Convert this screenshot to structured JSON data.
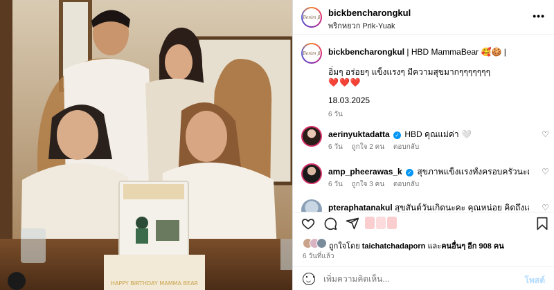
{
  "post": {
    "username": "bickbencharongkul",
    "location": "พริกหยวก Prik-Yuak",
    "avatar_text": "Benim ß"
  },
  "caption": {
    "username": "bickbencharongkul",
    "line1": "| HBD MammaBear 🥰🍪 |",
    "line2": "อิ่มๆ อร่อยๆ แข็งแรงๆ มีความสุขมากๆๆๆๆๆๆๆ",
    "hearts": "❤️❤️❤️",
    "date": "18.03.2025",
    "time": "6 วัน"
  },
  "comments": [
    {
      "username": "aerinyuktadatta",
      "text": "HBD คุณแม่ค่า 🤍",
      "time": "6 วัน",
      "likes": "ถูกใจ 2 คน",
      "reply": "ตอบกลับ"
    },
    {
      "username": "amp_pheerawas_k",
      "text": "สุขภาพแข็งแรงทั้งครอบครัวนะครับ",
      "time": "6 วัน",
      "likes": "ถูกใจ 3 คน",
      "reply": "ตอบกลับ"
    },
    {
      "username": "pteraphatanakul",
      "text": "สุขสันต์วันเกิดนะคะ คุณหน่อย คิดถึงเสมอคะ",
      "time": "",
      "likes": "",
      "reply": ""
    }
  ],
  "likes": {
    "prefix": "ถูกใจโดย",
    "user": "taichatchadaporn",
    "middle": "และ",
    "others": "คนอื่นๆ อีก 908 คน"
  },
  "posted_ago": "6 วันที่แล้ว",
  "add_comment": {
    "placeholder": "เพิ่มความคิดเห็น...",
    "post_label": "โพสต์"
  },
  "photo": {
    "cake_text": "HAPPY BIRTHDAY MAMMA BEAR"
  },
  "icons": {
    "like": "heart-icon",
    "comment": "comment-icon",
    "share": "share-icon",
    "save": "bookmark-icon",
    "more": "more-icon",
    "emoji": "emoji-icon"
  }
}
